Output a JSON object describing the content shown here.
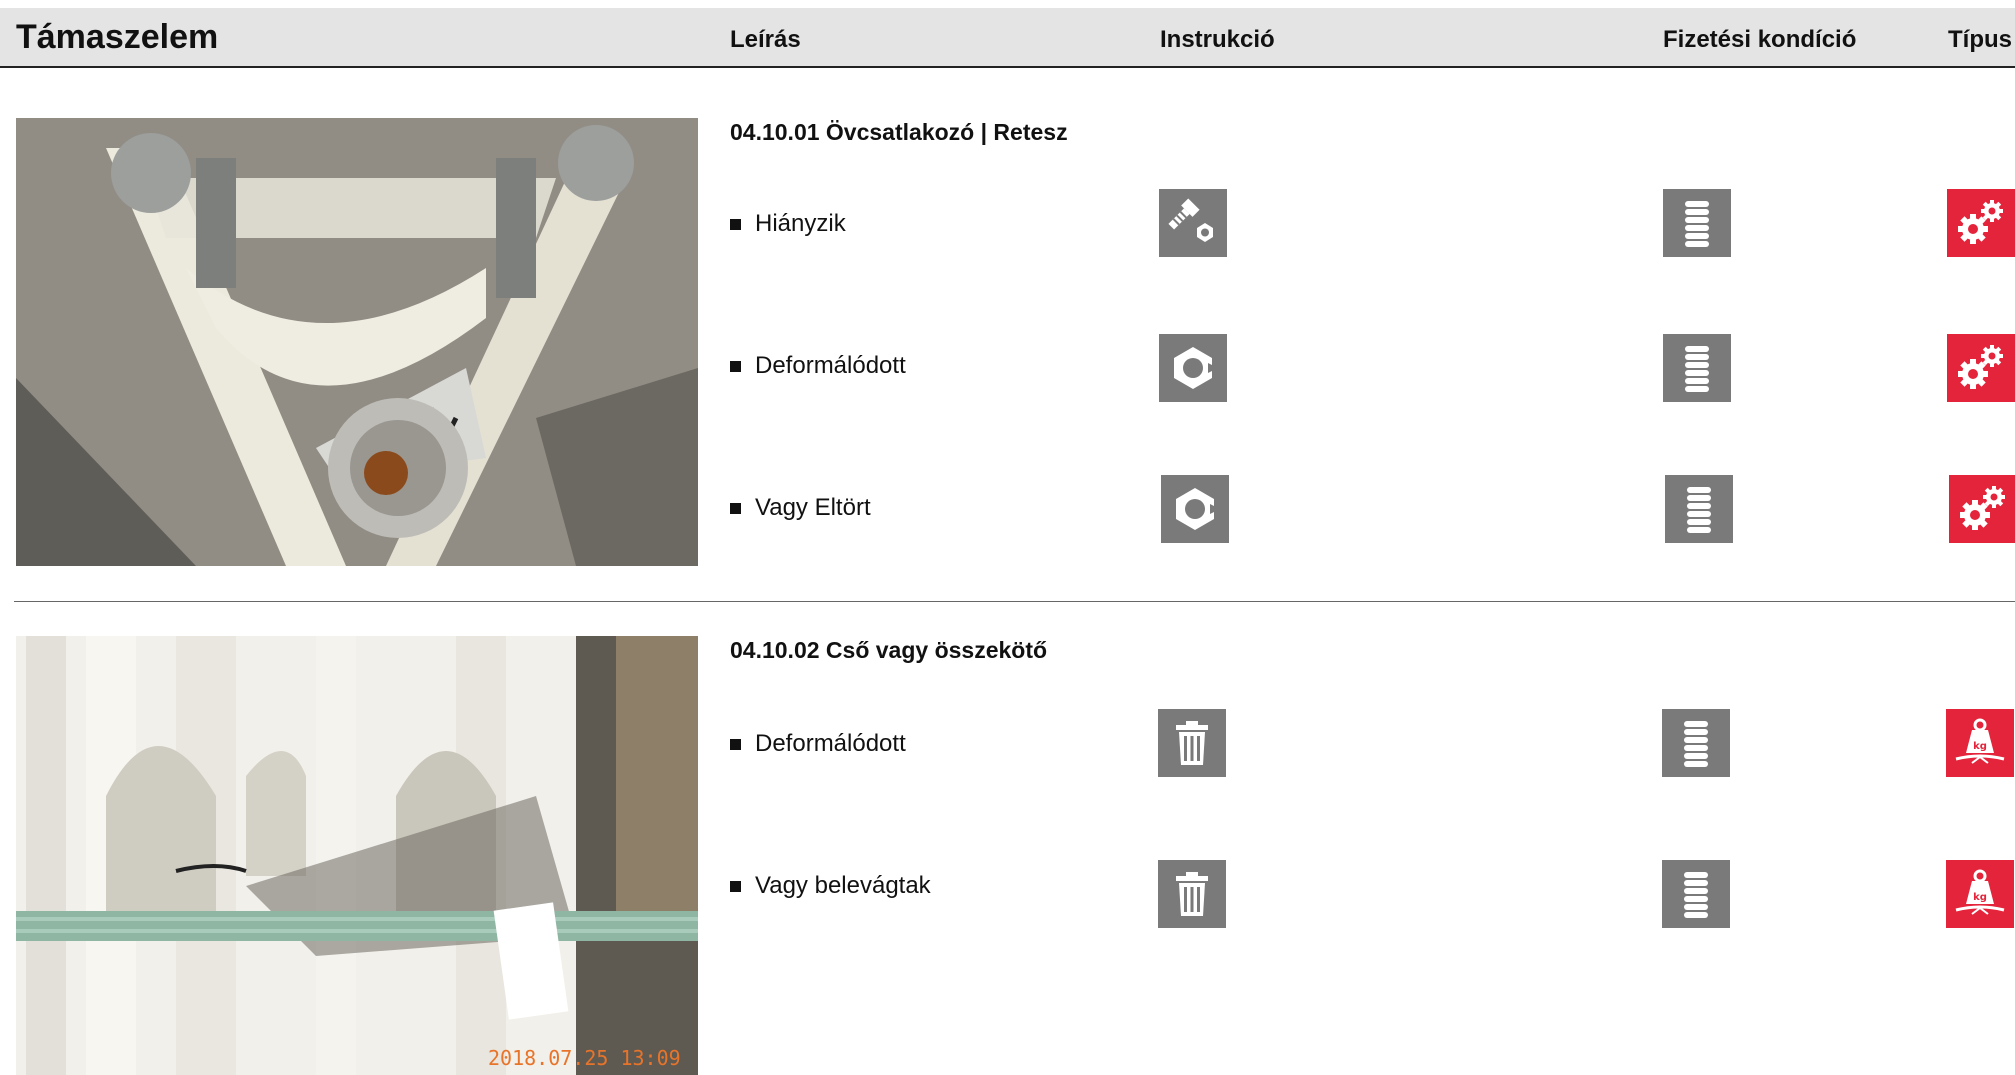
{
  "header": {
    "title": "Támaszelem",
    "col_description": "Leírás",
    "col_instruction": "Instrukció",
    "col_payment": "Fizetési kondíció",
    "col_type": "Típus"
  },
  "sections": [
    {
      "title": "04.10.01 Övcsatlakozó | Retesz",
      "items": [
        {
          "label": "Hiányzik",
          "instruction_icon": "bolt-nut-icon",
          "payment_icon": "coin-stack-icon",
          "type_icon": "gears-icon"
        },
        {
          "label": "Deformálódott",
          "instruction_icon": "broken-nut-icon",
          "payment_icon": "coin-stack-icon",
          "type_icon": "gears-icon"
        },
        {
          "label": "Vagy Eltört",
          "instruction_icon": "broken-nut-icon",
          "payment_icon": "coin-stack-icon",
          "type_icon": "gears-icon"
        }
      ]
    },
    {
      "title": "04.10.02 Cső vagy összekötő",
      "items": [
        {
          "label": "Deformálódott",
          "instruction_icon": "trash-icon",
          "payment_icon": "coin-stack-icon",
          "type_icon": "kg-weight-icon"
        },
        {
          "label": "Vagy belevágtak",
          "instruction_icon": "trash-icon",
          "payment_icon": "coin-stack-icon",
          "type_icon": "kg-weight-icon"
        }
      ]
    }
  ],
  "photo2_timestamp": "2018.07.25 13:09",
  "colors": {
    "grey_icon": "#7a7a7a",
    "red_icon": "#e3243b",
    "header_bg": "#e4e4e4"
  }
}
